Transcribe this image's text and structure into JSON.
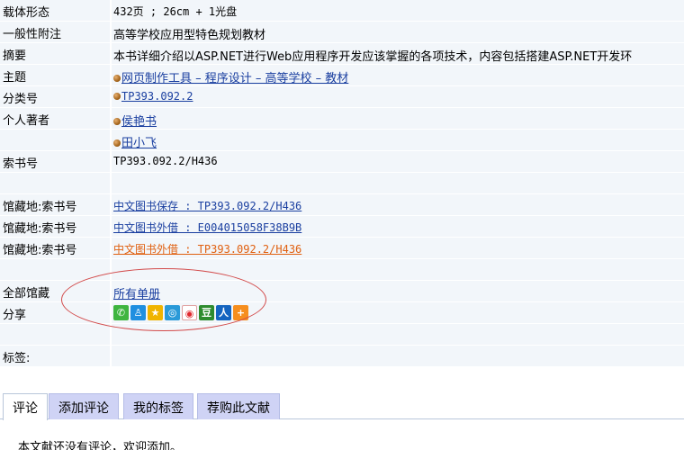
{
  "details": {
    "carrier_label": "载体形态",
    "carrier_value": "432页  ;  26cm  +  1光盘",
    "note_label": "一般性附注",
    "note_value": "高等学校应用型特色规划教材",
    "abstract_label": "摘要",
    "abstract_value": "本书详细介绍以ASP.NET进行Web应用程序开发应该掌握的各项技术，内容包括搭建ASP.NET开发环",
    "subject_label": "主题",
    "subject_value": "网页制作工具  –  程序设计  –  高等学校  –  教材",
    "class_label": "分类号",
    "class_value": "TP393.092.2",
    "author_label": "个人著者",
    "author1": "侯艳书",
    "author2": "田小飞",
    "callno_label": "索书号",
    "callno_value": "TP393.092.2/H436"
  },
  "holdings": [
    {
      "label": "馆藏地:索书号",
      "link": "中文图书保存  :  TP393.092.2/H436"
    },
    {
      "label": "馆藏地:索书号",
      "link": "中文图书外借  :  E004015058F38B9B"
    },
    {
      "label": "馆藏地:索书号",
      "link": "中文图书外借  :  TP393.092.2/H436"
    }
  ],
  "all_holdings": {
    "label": "全部馆藏",
    "link": "所有单册"
  },
  "share": {
    "label": "分享",
    "icons": [
      "wechat-icon",
      "qq-icon",
      "qzone-icon",
      "tencent-weibo-icon",
      "sina-weibo-icon",
      "douban-icon",
      "renren-icon",
      "more-share-icon"
    ]
  },
  "tags": {
    "label": "标签:"
  },
  "tabs": [
    "评论",
    "添加评论",
    "我的标签",
    "荐购此文献"
  ],
  "comments": {
    "empty_text": "本文献还没有评论，欢迎添加。"
  },
  "colors": {
    "row_bg": "#f2f6fa",
    "link": "#1a3fa0",
    "visited_link": "#e06010",
    "annotation_oval": "#d24a4a",
    "tab_bg": "#cfd3f5"
  }
}
